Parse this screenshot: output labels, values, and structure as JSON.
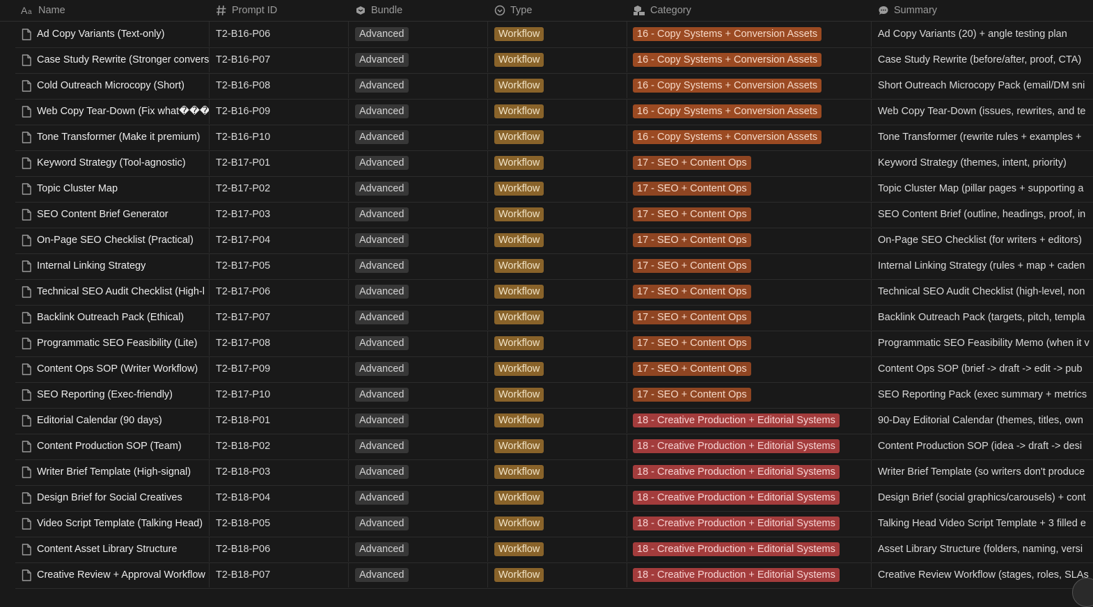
{
  "columns": [
    {
      "label": "Name",
      "icon": "text-property-icon"
    },
    {
      "label": "Prompt ID",
      "icon": "hash-icon"
    },
    {
      "label": "Bundle",
      "icon": "select-icon"
    },
    {
      "label": "Type",
      "icon": "status-icon"
    },
    {
      "label": "Category",
      "icon": "multi-select-icon"
    },
    {
      "label": "Summary",
      "icon": "speech-bubble-icon"
    }
  ],
  "colors": {
    "background": "#191919",
    "type_tag": "#89632a",
    "category_16_tag": "#9b4a22",
    "category_17_tag": "#8f4522",
    "category_18_tag": "#a33c3c",
    "bundle_tag": "#373737"
  },
  "rows": [
    {
      "name": "Ad Copy Variants (Text-only)",
      "id": "T2-B16-P06",
      "bundle": "Advanced",
      "type": "Workflow",
      "category": "16 - Copy Systems + Conversion Assets",
      "cat_group": "16",
      "summary": "Ad Copy Variants (20) + angle testing plan"
    },
    {
      "name": "Case Study Rewrite (Stronger convers",
      "id": "T2-B16-P07",
      "bundle": "Advanced",
      "type": "Workflow",
      "category": "16 - Copy Systems + Conversion Assets",
      "cat_group": "16",
      "summary": "Case Study Rewrite (before/after, proof, CTA)"
    },
    {
      "name": "Cold Outreach Microcopy (Short)",
      "id": "T2-B16-P08",
      "bundle": "Advanced",
      "type": "Workflow",
      "category": "16 - Copy Systems + Conversion Assets",
      "cat_group": "16",
      "summary": "Short Outreach Microcopy Pack (email/DM sni"
    },
    {
      "name": "Web Copy Tear-Down (Fix what���",
      "id": "T2-B16-P09",
      "bundle": "Advanced",
      "type": "Workflow",
      "category": "16 - Copy Systems + Conversion Assets",
      "cat_group": "16",
      "summary": "Web Copy Tear-Down (issues, rewrites, and te"
    },
    {
      "name": "Tone Transformer (Make it premium)",
      "id": "T2-B16-P10",
      "bundle": "Advanced",
      "type": "Workflow",
      "category": "16 - Copy Systems + Conversion Assets",
      "cat_group": "16",
      "summary": "Tone Transformer (rewrite rules + examples + "
    },
    {
      "name": "Keyword Strategy (Tool-agnostic)",
      "id": "T2-B17-P01",
      "bundle": "Advanced",
      "type": "Workflow",
      "category": "17 - SEO + Content Ops",
      "cat_group": "17",
      "summary": "Keyword Strategy (themes, intent, priority)"
    },
    {
      "name": "Topic Cluster Map",
      "id": "T2-B17-P02",
      "bundle": "Advanced",
      "type": "Workflow",
      "category": "17 - SEO + Content Ops",
      "cat_group": "17",
      "summary": "Topic Cluster Map (pillar pages + supporting a"
    },
    {
      "name": "SEO Content Brief Generator",
      "id": "T2-B17-P03",
      "bundle": "Advanced",
      "type": "Workflow",
      "category": "17 - SEO + Content Ops",
      "cat_group": "17",
      "summary": "SEO Content Brief (outline, headings, proof, in"
    },
    {
      "name": "On-Page SEO Checklist (Practical)",
      "id": "T2-B17-P04",
      "bundle": "Advanced",
      "type": "Workflow",
      "category": "17 - SEO + Content Ops",
      "cat_group": "17",
      "summary": "On-Page SEO Checklist (for writers + editors)"
    },
    {
      "name": "Internal Linking Strategy",
      "id": "T2-B17-P05",
      "bundle": "Advanced",
      "type": "Workflow",
      "category": "17 - SEO + Content Ops",
      "cat_group": "17",
      "summary": "Internal Linking Strategy (rules + map + caden"
    },
    {
      "name": "Technical SEO Audit Checklist (High-l",
      "id": "T2-B17-P06",
      "bundle": "Advanced",
      "type": "Workflow",
      "category": "17 - SEO + Content Ops",
      "cat_group": "17",
      "summary": "Technical SEO Audit Checklist (high-level, non"
    },
    {
      "name": "Backlink Outreach Pack (Ethical)",
      "id": "T2-B17-P07",
      "bundle": "Advanced",
      "type": "Workflow",
      "category": "17 - SEO + Content Ops",
      "cat_group": "17",
      "summary": "Backlink Outreach Pack (targets, pitch, templa"
    },
    {
      "name": "Programmatic SEO Feasibility (Lite)",
      "id": "T2-B17-P08",
      "bundle": "Advanced",
      "type": "Workflow",
      "category": "17 - SEO + Content Ops",
      "cat_group": "17",
      "summary": "Programmatic SEO Feasibility Memo (when it v"
    },
    {
      "name": "Content Ops SOP (Writer Workflow)",
      "id": "T2-B17-P09",
      "bundle": "Advanced",
      "type": "Workflow",
      "category": "17 - SEO + Content Ops",
      "cat_group": "17",
      "summary": "Content Ops SOP (brief -> draft -> edit -> pub"
    },
    {
      "name": "SEO Reporting (Exec-friendly)",
      "id": "T2-B17-P10",
      "bundle": "Advanced",
      "type": "Workflow",
      "category": "17 - SEO + Content Ops",
      "cat_group": "17",
      "summary": "SEO Reporting Pack (exec summary + metrics"
    },
    {
      "name": "Editorial Calendar (90 days)",
      "id": "T2-B18-P01",
      "bundle": "Advanced",
      "type": "Workflow",
      "category": "18 - Creative Production + Editorial Systems",
      "cat_group": "18",
      "summary": "90-Day Editorial Calendar (themes, titles, own"
    },
    {
      "name": "Content Production SOP (Team)",
      "id": "T2-B18-P02",
      "bundle": "Advanced",
      "type": "Workflow",
      "category": "18 - Creative Production + Editorial Systems",
      "cat_group": "18",
      "summary": "Content Production SOP (idea -> draft -> desi"
    },
    {
      "name": "Writer Brief Template (High-signal)",
      "id": "T2-B18-P03",
      "bundle": "Advanced",
      "type": "Workflow",
      "category": "18 - Creative Production + Editorial Systems",
      "cat_group": "18",
      "summary": "Writer Brief Template (so writers don't produce"
    },
    {
      "name": "Design Brief for Social Creatives",
      "id": "T2-B18-P04",
      "bundle": "Advanced",
      "type": "Workflow",
      "category": "18 - Creative Production + Editorial Systems",
      "cat_group": "18",
      "summary": "Design Brief (social graphics/carousels) + cont"
    },
    {
      "name": "Video Script Template (Talking Head)",
      "id": "T2-B18-P05",
      "bundle": "Advanced",
      "type": "Workflow",
      "category": "18 - Creative Production + Editorial Systems",
      "cat_group": "18",
      "summary": "Talking Head Video Script Template + 3 filled e"
    },
    {
      "name": "Content Asset Library Structure",
      "id": "T2-B18-P06",
      "bundle": "Advanced",
      "type": "Workflow",
      "category": "18 - Creative Production + Editorial Systems",
      "cat_group": "18",
      "summary": "Asset Library Structure (folders, naming, versi"
    },
    {
      "name": "Creative Review + Approval Workflow",
      "id": "T2-B18-P07",
      "bundle": "Advanced",
      "type": "Workflow",
      "category": "18 - Creative Production + Editorial Systems",
      "cat_group": "18",
      "summary": "Creative Review Workflow (stages, roles, SLAs"
    }
  ]
}
